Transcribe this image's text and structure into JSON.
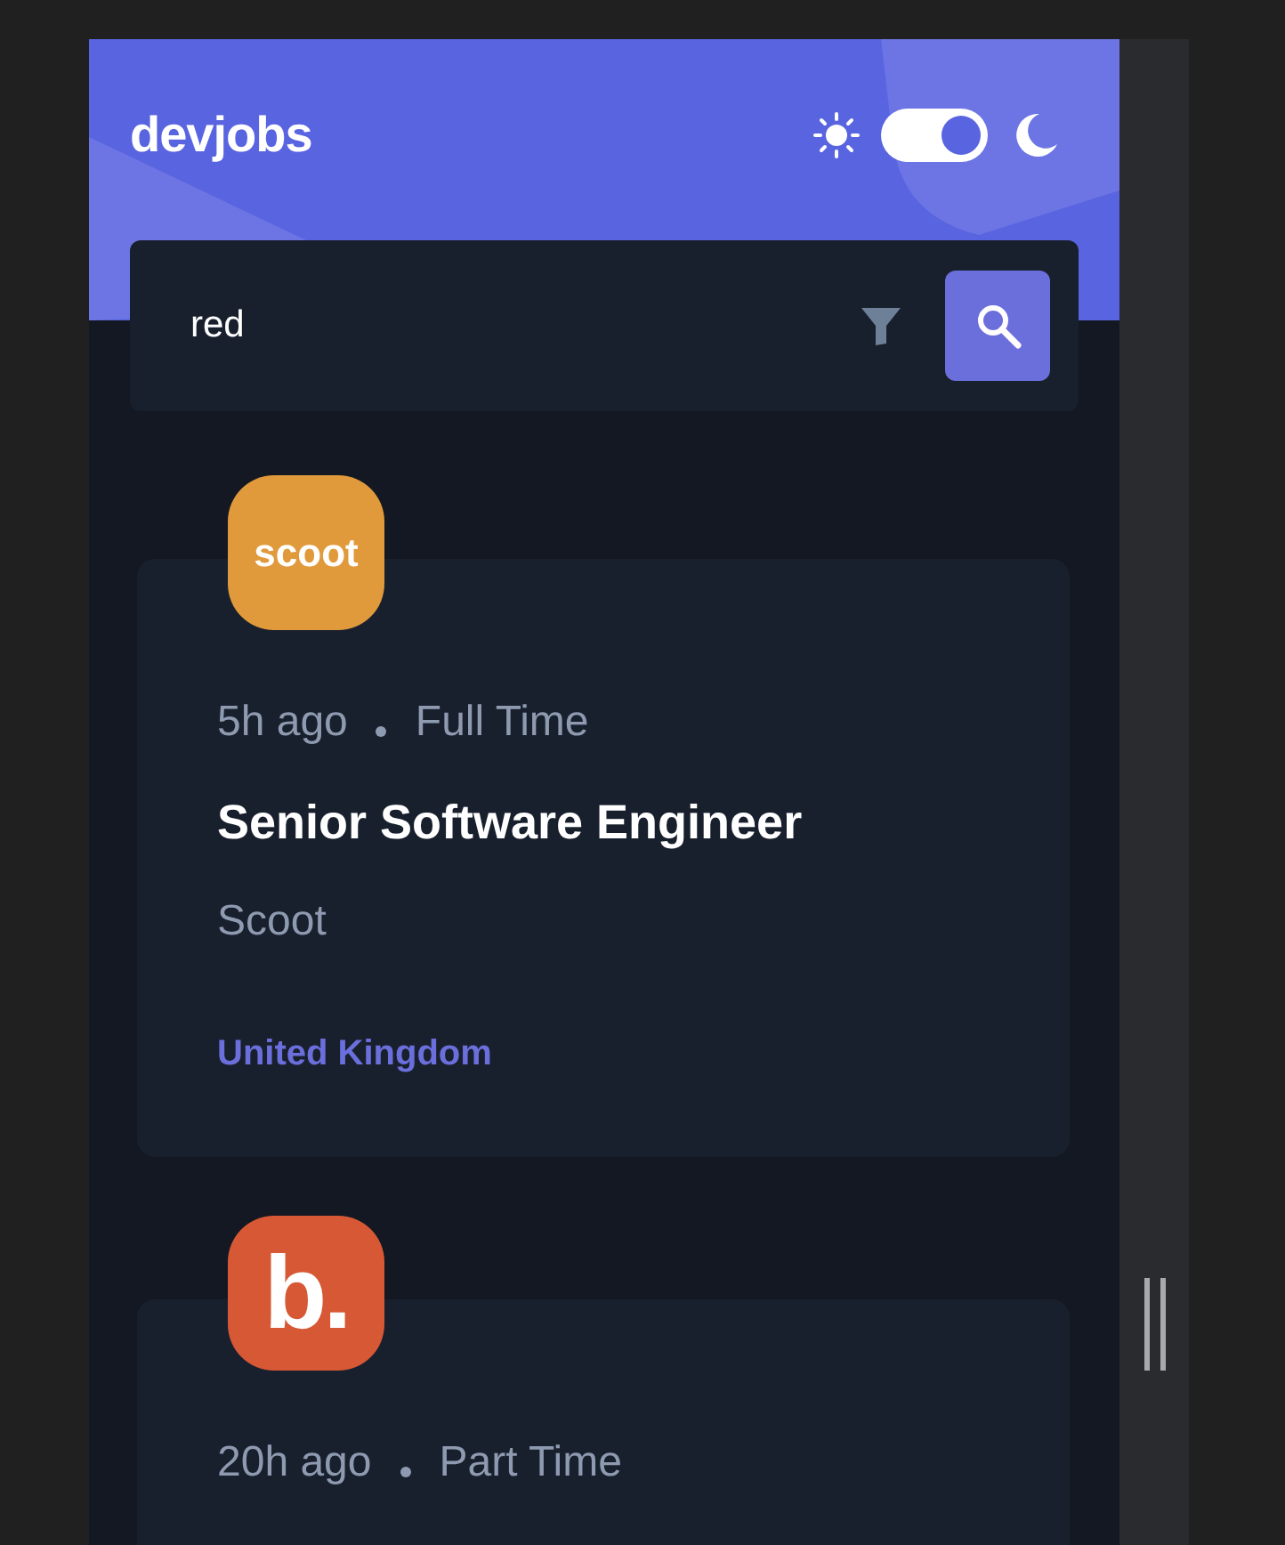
{
  "header": {
    "brand": "devjobs",
    "dark_mode": true
  },
  "search": {
    "value": "red"
  },
  "jobs": [
    {
      "logo": "scoot",
      "color": "#e09a3b",
      "posted": "5h ago",
      "contract": "Full Time",
      "position": "Senior Software Engineer",
      "company": "Scoot",
      "location": "United Kingdom"
    },
    {
      "logo": "b.",
      "color": "#d65835",
      "posted": "20h ago",
      "contract": "Part Time"
    }
  ]
}
